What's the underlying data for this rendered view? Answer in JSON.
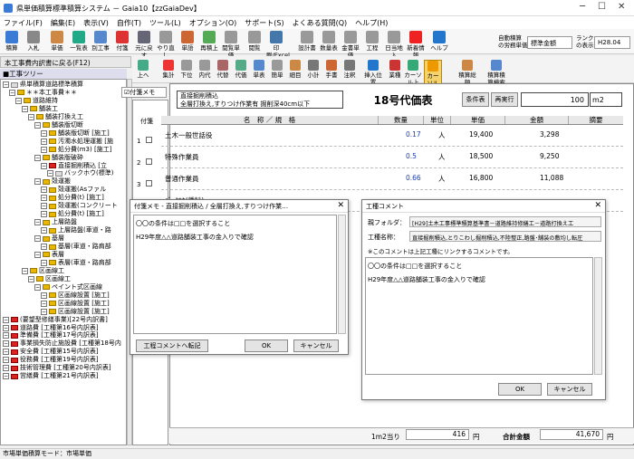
{
  "window": {
    "title": "県単価積算標準積算システム － Gaia10【zzGaiaDev】"
  },
  "menu": [
    "ファイル(F)",
    "編集(E)",
    "表示(V)",
    "自作(T)",
    "ツール(L)",
    "オプション(O)",
    "サポート(S)",
    "よくある質問(Q)",
    "ヘルプ(H)"
  ],
  "toolbar": [
    "積算",
    "入札",
    "単価",
    "一覧表",
    "別工事",
    "付箋",
    "元に戻す",
    "やり直し",
    "単語",
    "再積上",
    "閲覧単価",
    "閲覧",
    "印刷/Excel",
    "設計書",
    "数量表",
    "金書単価",
    "工程",
    "日当地入",
    "新着情報",
    "ヘルプ"
  ],
  "toolbar_right": {
    "label1": "自動積算",
    "label2": "の労務単価",
    "select1": "標準金額",
    "label3": "ランク",
    "label4": "の表示",
    "select2": "H28.04"
  },
  "left": {
    "button": "本工事費内訳書に戻る(F12)",
    "tree_header": "■工事ツリー",
    "tree": [
      {
        "t": "県単積算道路標準積算",
        "d": 0,
        "c": "w"
      },
      {
        "t": "＊＊本工事費＊＊",
        "d": 1,
        "c": "y"
      },
      {
        "t": "道路維持",
        "d": 2,
        "c": "y"
      },
      {
        "t": "舗装工",
        "d": 3,
        "c": "y"
      },
      {
        "t": "舗装打換え工",
        "d": 4,
        "c": "y"
      },
      {
        "t": "舗装版切断",
        "d": 5,
        "c": "y"
      },
      {
        "t": "舗装版切断 [施工]",
        "d": 6,
        "c": "y"
      },
      {
        "t": "汚濁水処理運搬 [施",
        "d": 6,
        "c": "y"
      },
      {
        "t": "処分費(m3) [施工]",
        "d": 6,
        "c": "y"
      },
      {
        "t": "舗装版破砕",
        "d": 5,
        "c": "y"
      },
      {
        "t": "直接掘削積込 [立",
        "d": 6,
        "c": "r"
      },
      {
        "t": "バックホウ(標準)",
        "d": 7,
        "c": "w"
      },
      {
        "t": "殻運搬",
        "d": 5,
        "c": "y"
      },
      {
        "t": "殻運搬(Asファル",
        "d": 6,
        "c": "y"
      },
      {
        "t": "処分費(t) [施工]",
        "d": 6,
        "c": "y"
      },
      {
        "t": "殻運搬(コンクリート",
        "d": 6,
        "c": "y"
      },
      {
        "t": "処分費(t) [施工]",
        "d": 6,
        "c": "y"
      },
      {
        "t": "上層路盤",
        "d": 5,
        "c": "y"
      },
      {
        "t": "上層路盤(車道・路",
        "d": 6,
        "c": "y"
      },
      {
        "t": "基層",
        "d": 5,
        "c": "y"
      },
      {
        "t": "基層(車道・路肩部",
        "d": 6,
        "c": "y"
      },
      {
        "t": "表層",
        "d": 5,
        "c": "y"
      },
      {
        "t": "表層(車道・路肩部",
        "d": 6,
        "c": "y"
      },
      {
        "t": "区画線工",
        "d": 3,
        "c": "y"
      },
      {
        "t": "区画線工",
        "d": 4,
        "c": "y"
      },
      {
        "t": "ペイント式区画線",
        "d": 5,
        "c": "y"
      },
      {
        "t": "区画線設置 [施工]",
        "d": 6,
        "c": "y"
      },
      {
        "t": "区画線設置 [施工]",
        "d": 6,
        "c": "y"
      },
      {
        "t": "区画線設置 [施工]",
        "d": 6,
        "c": "y"
      },
      {
        "t": "(要望型修繕事業)[22号内訳書]",
        "d": 0,
        "c": "r"
      },
      {
        "t": "道路費 [工種第16号内訳表]",
        "d": 0,
        "c": "r"
      },
      {
        "t": "準備費 [工種第17号内訳表]",
        "d": 0,
        "c": "r"
      },
      {
        "t": "事業損失防止施設費 [工種第18号内",
        "d": 0,
        "c": "r"
      },
      {
        "t": "安全費 [工種第15号内訳表]",
        "d": 0,
        "c": "r"
      },
      {
        "t": "役務費 [工種第19号内訳表]",
        "d": 0,
        "c": "r"
      },
      {
        "t": "技術管理費 [工種第20号内訳表]",
        "d": 0,
        "c": "r"
      },
      {
        "t": "営繕費 [工種第21号内訳表]",
        "d": 0,
        "c": "r"
      }
    ]
  },
  "toolbar2": [
    "上へ",
    "集計",
    "下位",
    "内代",
    "代替",
    "代価",
    "単表",
    "簡単",
    "細目",
    "小計",
    "手書",
    "注釈",
    "挿入位置",
    "業種",
    "カーソル上",
    "カーソル下",
    "積算総額",
    "積算積算検索"
  ],
  "main": {
    "fusen_label": "付箋メモ",
    "fusen_col": "付箋",
    "hdr_line1": "直接掘削積込",
    "hdr_line2": "全層打換え,すりつけ作業有 掘削深40cm以下",
    "title": "18号代価表",
    "btn_cond": "条件表",
    "btn_reexec": "再実行",
    "qty": "100",
    "unit": "m2",
    "cols": [
      "名　称 ／ 規　格",
      "数量",
      "単位",
      "単価",
      "金額",
      "摘要"
    ],
    "rows": [
      {
        "n": "1",
        "name": "土木一般世話役",
        "qty": "0.17",
        "unit": "人",
        "price": "19,400",
        "amt": "3,298"
      },
      {
        "n": "2",
        "name": "特殊作業員",
        "qty": "0.5",
        "unit": "人",
        "price": "18,500",
        "amt": "9,250"
      },
      {
        "n": "3",
        "name": "普通作業員",
        "qty": "0.66",
        "unit": "人",
        "price": "16,800",
        "amt": "11,088"
      },
      {
        "n": "4",
        "name": "ﾊﾞｯｸﾎｳ(賃料)",
        "qty": "",
        "unit": "",
        "price": "",
        "amt": ""
      }
    ],
    "per_label": "1m2当り",
    "per_value": "416",
    "yen1": "円",
    "total_label": "合計金額",
    "total_value": "41,670",
    "yen2": "円"
  },
  "dialog1": {
    "title": "付箋メモ - 直接掘削積込 / 全層打換え,すりつけ作業…",
    "line1": "〇〇の条件は□□を選択すること",
    "line2": "H29年度△△道路舗装工事の金入りで確認",
    "btn_copy": "工程コメントへ転記",
    "btn_ok": "OK",
    "btn_cancel": "キャンセル"
  },
  "dialog2": {
    "title": "工種コメント",
    "folder_label": "親フォルダ：",
    "folder_value": "[H29]土木工事標準積算基準書－道路維持修繕工－道路打換え工",
    "name_label": "工種名称：",
    "name_value": "直接掘削積込,とりこわし掘削積込,不陸整正,路盤･舗装の敷均し転圧",
    "note": "※このコメントは上記工種にリンクするコメントです。",
    "line1": "〇〇の条件は□□を選択すること",
    "line2": "H29年度△△道路舗装工事の金入りで確認",
    "btn_ok": "OK",
    "btn_cancel": "キャンセル"
  },
  "status": "市場単価積算モード：市場単価"
}
